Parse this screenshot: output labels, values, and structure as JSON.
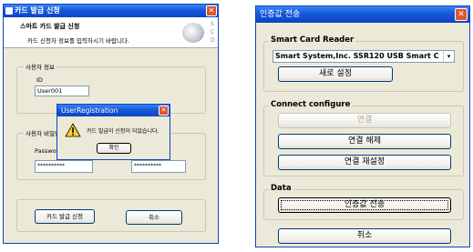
{
  "left_window": {
    "title": "카드 발급 신청",
    "header_title": "스마트 카드 발급 신청",
    "header_subtitle": "카드 신청자 정보를 입력하시기 바랍니다.",
    "logo_text": "SCD",
    "group_user_info": "사용자 정보",
    "id_label": "ID",
    "id_value": "User001",
    "group_password": "사용자 비밀번호",
    "password_label": "Passwo",
    "password_value": "**********",
    "password_confirm_value": "**********",
    "apply_button": "카드 발급 신청",
    "cancel_button": "취소"
  },
  "dialog": {
    "title": "UserRegistration",
    "message": "카드 발급이 신청이 되었습니다.",
    "ok_button": "확인",
    "icon": "warning-icon"
  },
  "right_window": {
    "title": "인증값 전송",
    "group_reader": "Smart Card Reader",
    "reader_selected": "Smart System,Inc. SSR120 USB Smart C",
    "refresh_button": "새로 설정",
    "group_connect": "Connect configure",
    "connect_button": "연결",
    "disconnect_button": "연결 해제",
    "reconnect_button": "연결 재설정",
    "group_data": "Data",
    "send_button": "인증값 전송",
    "cancel_button": "취소"
  },
  "colors": {
    "title_blue": "#0b44c4",
    "window_face": "#ece9d8",
    "close_red": "#e0552f",
    "disabled_text": "#aca899"
  }
}
